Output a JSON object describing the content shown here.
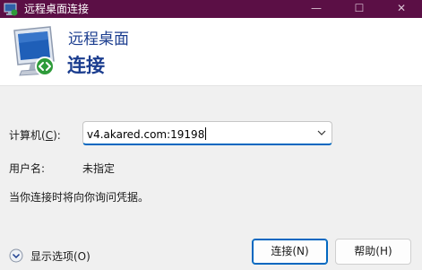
{
  "window": {
    "title": "远程桌面连接",
    "controls": {
      "minimize": "—",
      "maximize": "☐",
      "close": "✕"
    }
  },
  "header": {
    "line1": "远程桌面",
    "line2": "连接"
  },
  "form": {
    "computer_label_prefix": "计算机(",
    "computer_label_accel": "C",
    "computer_label_suffix": "):",
    "computer_value": "v4.akared.com:19198",
    "user_label": "用户名:",
    "user_value": "未指定",
    "info_text": "当你连接时将向你询问凭据。"
  },
  "footer": {
    "options_label": "显示选项(O)",
    "connect_label": "连接(N)",
    "help_label": "帮助(H)"
  },
  "colors": {
    "titlebar": "#5b0f45",
    "header_text": "#1b3d8f",
    "accent": "#0067c0"
  },
  "icons": {
    "app": "remote-desktop-icon",
    "header": "monitor-connection-icon",
    "dropdown": "chevron-down-icon",
    "options": "expand-circle-icon"
  }
}
